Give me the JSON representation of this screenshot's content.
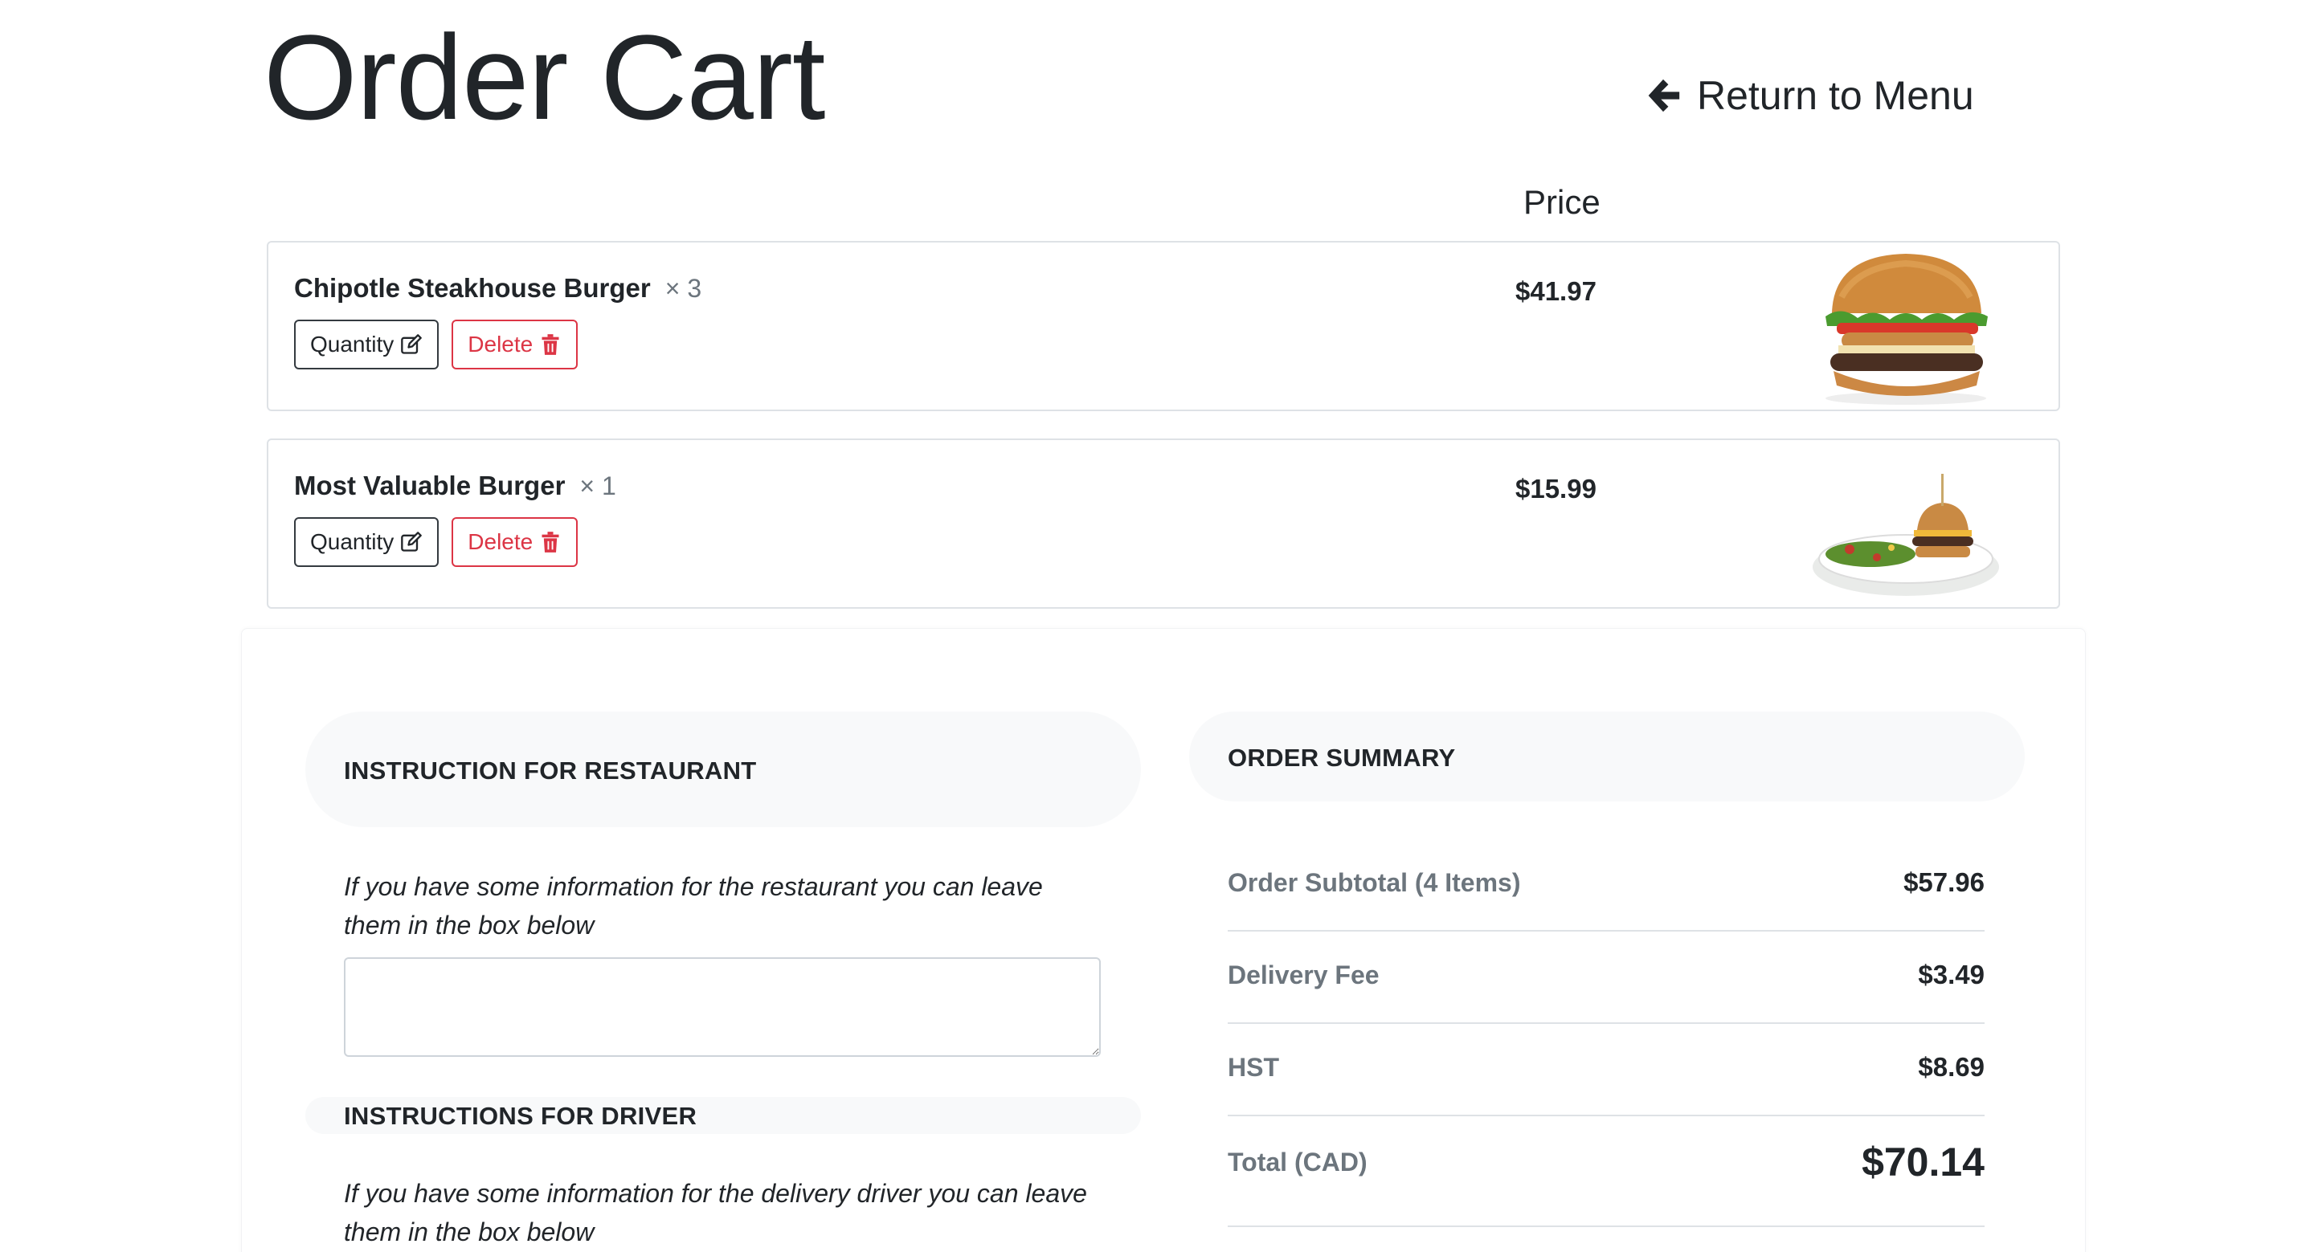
{
  "header": {
    "title": "Order Cart",
    "return_label": "Return to Menu"
  },
  "cart": {
    "price_header": "Price",
    "items": [
      {
        "name": "Chipotle Steakhouse Burger",
        "quantity": "× 3",
        "price": "$41.97",
        "quantity_button": "Quantity",
        "delete_button": "Delete",
        "image": "burger-photo"
      },
      {
        "name": "Most Valuable Burger",
        "quantity": "× 1",
        "price": "$15.99",
        "quantity_button": "Quantity",
        "delete_button": "Delete",
        "image": "burger-plate-photo"
      }
    ]
  },
  "instructions": {
    "restaurant_heading": "INSTRUCTION FOR RESTAURANT",
    "restaurant_text": "If you have some information for the restaurant you can leave them in the box below",
    "restaurant_value": "",
    "driver_heading": "INSTRUCTIONS FOR DRIVER",
    "driver_text": "If you have some information for the delivery driver you can leave them in the box below"
  },
  "summary": {
    "heading": "ORDER SUMMARY",
    "rows": [
      {
        "label": "Order Subtotal (4 Items)",
        "value": "$57.96"
      },
      {
        "label": "Delivery Fee",
        "value": "$3.49"
      },
      {
        "label": "HST",
        "value": "$8.69"
      }
    ],
    "total_label": "Total (CAD)",
    "total_value": "$70.14"
  },
  "colors": {
    "danger": "#dc3545",
    "muted": "#6c757d",
    "text": "#212529",
    "pill_bg": "#f8f9fa"
  },
  "icons": [
    "arrow-left-icon",
    "edit-icon",
    "trash-icon"
  ]
}
